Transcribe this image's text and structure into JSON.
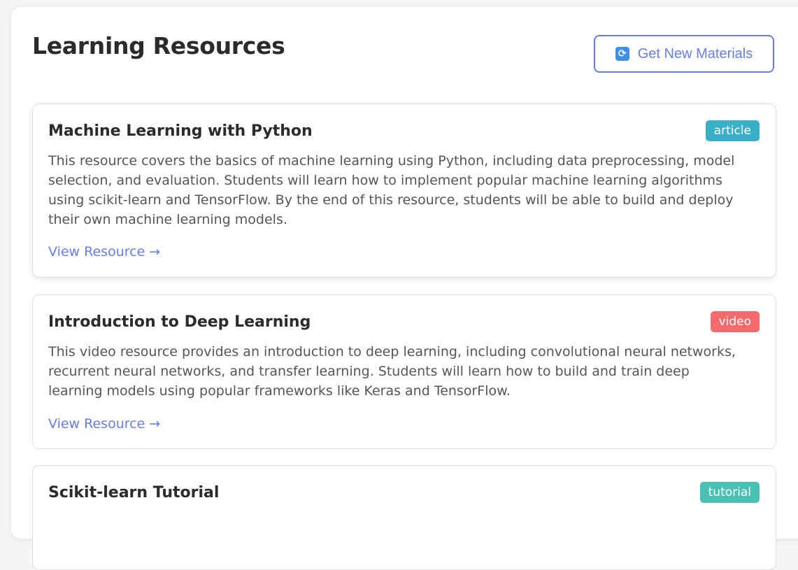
{
  "header": {
    "title": "Learning Resources",
    "refresh_button_label": "Get New Materials",
    "refresh_icon": "refresh-icon"
  },
  "colors": {
    "accent": "#667eea",
    "badge_article": "#3ab0c8",
    "badge_video": "#f56b6b",
    "badge_tutorial": "#48c1b4"
  },
  "resources": [
    {
      "title": "Machine Learning with Python",
      "type": "article",
      "description": "This resource covers the basics of machine learning using Python, including data preprocessing, model selection, and evaluation. Students will learn how to implement popular machine learning algorithms using scikit-learn and TensorFlow. By the end of this resource, students will be able to build and deploy their own machine learning models.",
      "link_label": "View Resource →"
    },
    {
      "title": "Introduction to Deep Learning",
      "type": "video",
      "description": "This video resource provides an introduction to deep learning, including convolutional neural networks, recurrent neural networks, and transfer learning. Students will learn how to build and train deep learning models using popular frameworks like Keras and TensorFlow.",
      "link_label": "View Resource →"
    },
    {
      "title": "Scikit-learn Tutorial",
      "type": "tutorial"
    }
  ]
}
